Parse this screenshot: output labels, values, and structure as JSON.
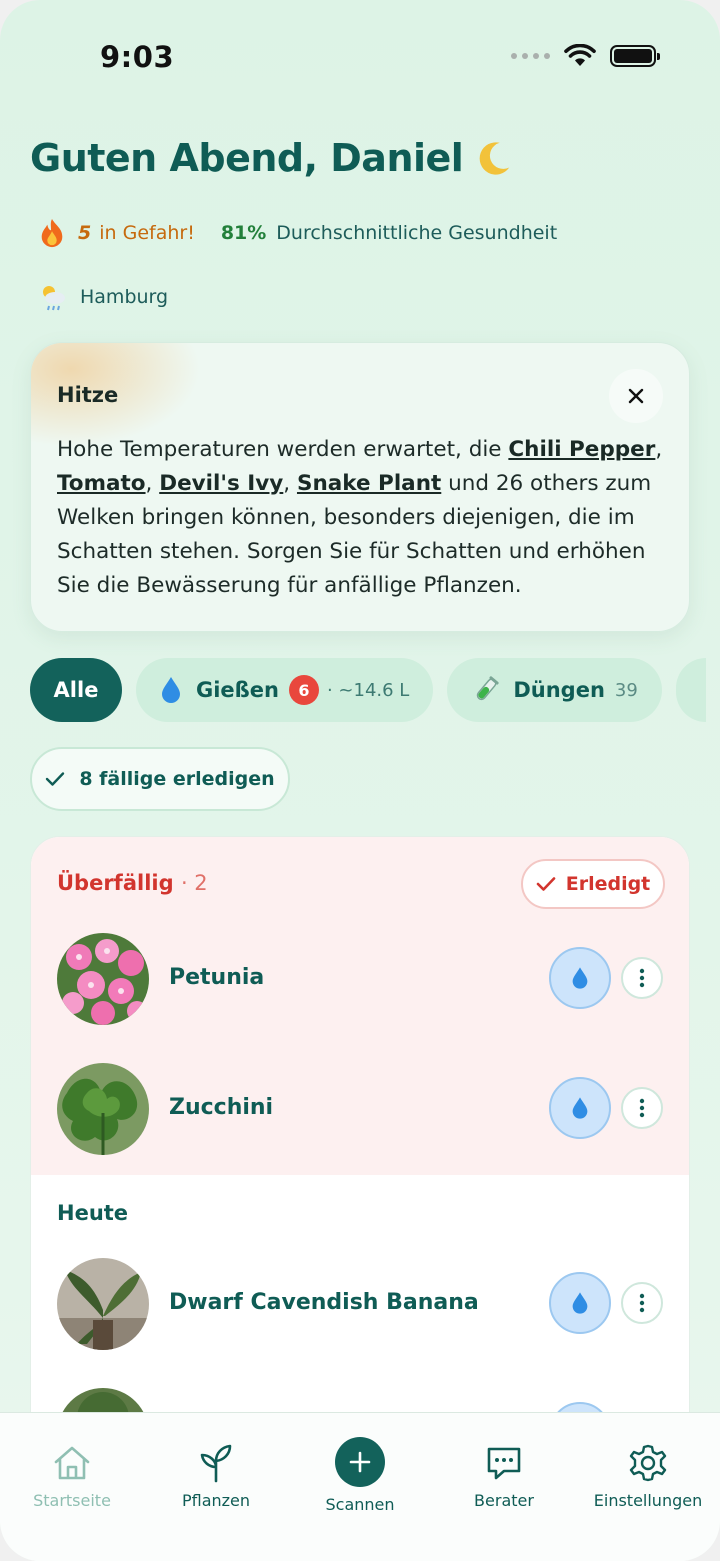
{
  "status_bar": {
    "time": "9:03"
  },
  "header": {
    "greeting": "Guten Abend, Daniel",
    "danger_count": "5",
    "danger_label": "in Gefahr!",
    "health_value": "81%",
    "health_label": "Durchschnittliche Gesundheit",
    "location": "Hamburg"
  },
  "alert": {
    "title": "Hitze",
    "text_before": "Hohe Temperaturen werden erwartet, die ",
    "plant_1": "Chili Pepper",
    "sep_1": ", ",
    "plant_2": "Tomato",
    "sep_2": ", ",
    "plant_3": "Devil's Ivy",
    "sep_3": ", ",
    "plant_4": "Snake Plant",
    "text_after": " und 26 others zum Welken bringen können, besonders diejenigen, die im Schatten stehen. Sorgen Sie für Schatten und erhöhen Sie die Bewässerung für anfällige Pflanzen."
  },
  "filters": {
    "all": "Alle",
    "water_label": "Gießen",
    "water_badge": "6",
    "water_amount": "· ~14.6 L",
    "fertilize_label": "Düngen",
    "fertilize_count": "39"
  },
  "complete_all": "8 fällige erledigen",
  "overdue": {
    "title": "Überfällig",
    "count": "· 2",
    "done_label": "Erledigt",
    "plants": [
      {
        "name": "Petunia"
      },
      {
        "name": "Zucchini"
      }
    ]
  },
  "today": {
    "title": "Heute",
    "plants": [
      {
        "name": "Dwarf Cavendish Banana"
      }
    ]
  },
  "tabs": [
    {
      "label": "Startseite",
      "icon": "home-icon",
      "active": true
    },
    {
      "label": "Pflanzen",
      "icon": "sprout-icon"
    },
    {
      "label": "Scannen",
      "icon": "plus-icon"
    },
    {
      "label": "Berater",
      "icon": "chat-icon"
    },
    {
      "label": "Einstellungen",
      "icon": "gear-icon"
    }
  ],
  "colors": {
    "brand": "#13625b",
    "danger": "#d2352e",
    "warning": "#c66a0e",
    "health": "#23803b",
    "water": "#cde4fb"
  }
}
